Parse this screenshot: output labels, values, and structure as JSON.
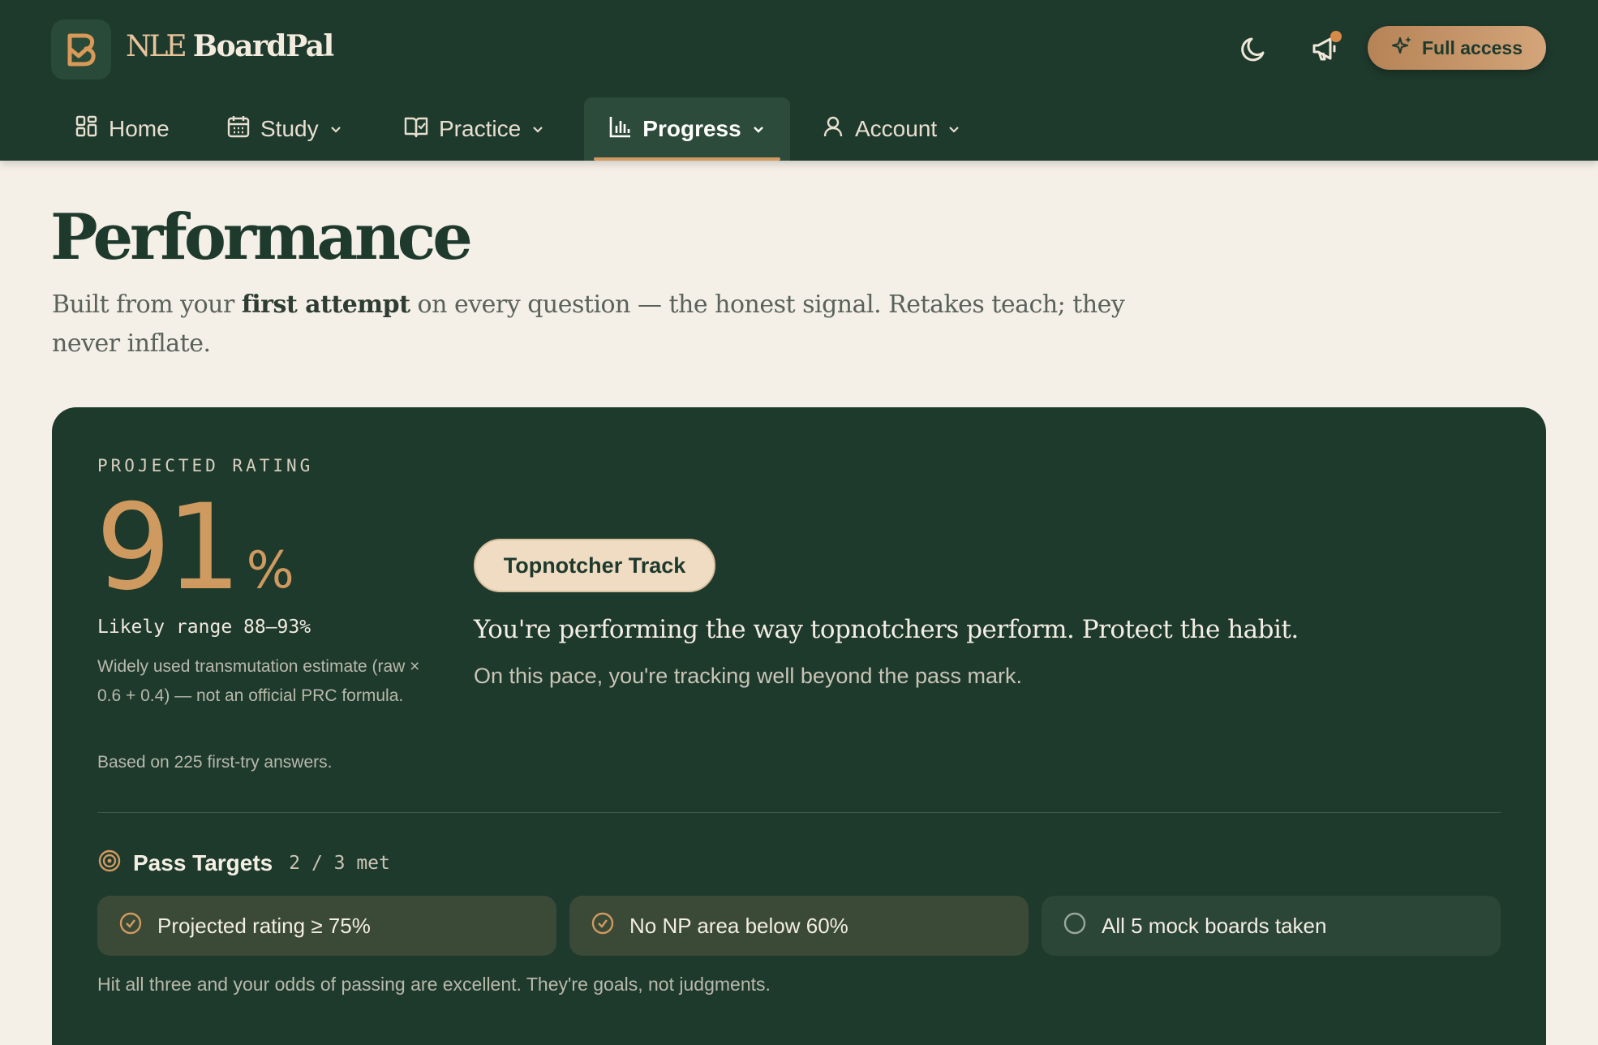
{
  "app": {
    "brand_prefix": "NLE",
    "brand_name": "BoardPal",
    "logo_icon": "bookmark-b-logo",
    "theme_icon": "moon-icon",
    "announcements_icon": "megaphone-icon",
    "cta_label": "Full access",
    "cta_icon": "sparkles-icon"
  },
  "nav": {
    "items": [
      {
        "label": "Home",
        "icon": "grid-icon"
      },
      {
        "label": "Study",
        "icon": "calendar-icon"
      },
      {
        "label": "Practice",
        "icon": "book-check-icon"
      },
      {
        "label": "Progress",
        "icon": "bar-chart-icon"
      },
      {
        "label": "Account",
        "icon": "user-icon"
      }
    ],
    "active": "Progress"
  },
  "page": {
    "title": "Performance",
    "subtitle_pre": "Built from your ",
    "subtitle_bold": "first attempt",
    "subtitle_post": " on every question — the honest signal. Retakes teach; they never inflate."
  },
  "rating": {
    "label": "PROJECTED RATING",
    "value": "91",
    "unit": "%",
    "range": "Likely range 88–93%",
    "note": "Widely used transmutation estimate (raw × 0.6 + 0.4) — not an official PRC formula.",
    "based_on": "Based on 225 first-try answers."
  },
  "track": {
    "badge": "Topnotcher Track",
    "headline": "You're performing the way topnotchers perform. Protect the habit.",
    "detail": "On this pace, you're tracking well beyond the pass mark."
  },
  "targets": {
    "title": "Pass Targets",
    "count": "2 / 3 met",
    "items": [
      {
        "label": "Projected rating ≥ 75%",
        "met": true
      },
      {
        "label": "No NP area below 60%",
        "met": true
      },
      {
        "label": "All 5 mock boards taken",
        "met": false
      }
    ],
    "footnote": "Hit all three and your odds of passing are excellent. They're goals, not judgments."
  },
  "colors": {
    "header_bg": "#1e3a2d",
    "page_bg": "#f4efe7",
    "accent": "#cf9a5f",
    "pill_bg": "#efdcc3"
  }
}
